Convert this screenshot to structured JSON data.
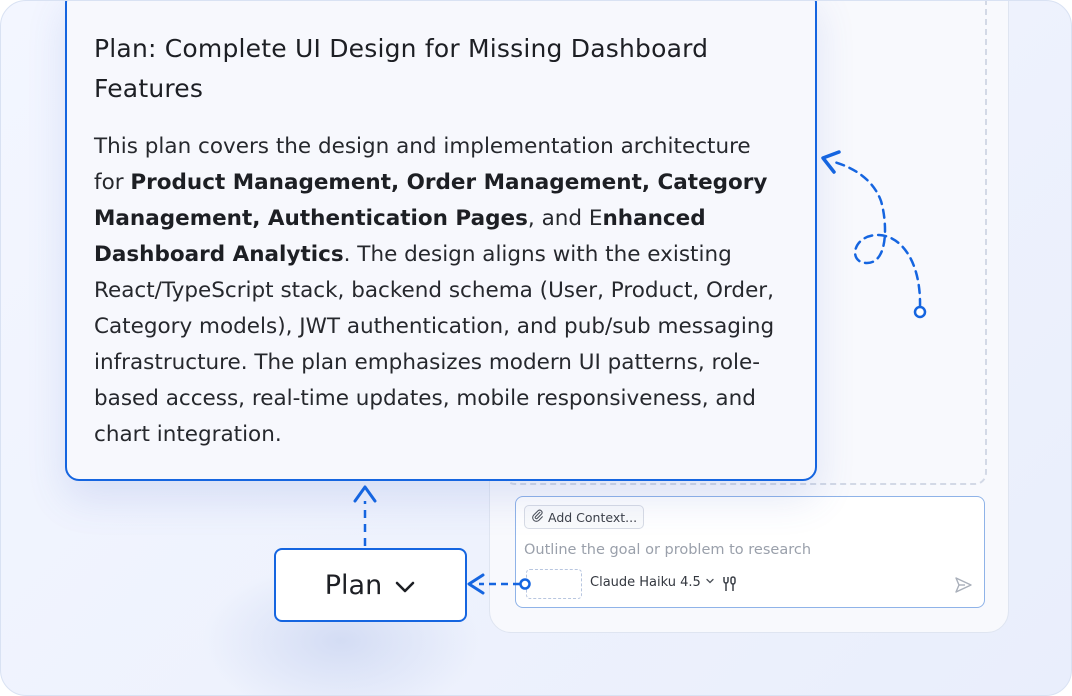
{
  "plan_card": {
    "title": "Plan: Complete UI Design for Missing Dashboard Features",
    "body_1": "This plan covers the design and implementation architecture for ",
    "bold_1": "Product Management, Order Management, Category Management, Authentication Pages",
    "body_2": ", and E",
    "bold_2": "nhanced Dashboard Analytics",
    "body_3": ". The design aligns with the existing React/TypeScript stack, backend schema (User, Product, Order, Category models), JWT authentication, and pub/sub messaging infrastructure. The plan emphasizes modern UI patterns, role-based access, real-time updates, mobile responsiveness, and chart integration."
  },
  "chat": {
    "add_context_label": "Add Context...",
    "placeholder": "Outline the goal or problem to research",
    "model_label": "Claude Haiku 4.5",
    "icons": [
      "paperclip-icon",
      "chevron-down-icon",
      "tools-icon",
      "send-icon"
    ]
  },
  "mode_button": {
    "label": "Plan",
    "icon": "chevron-down-icon"
  },
  "colors": {
    "accent": "#1565e0",
    "background": "#eef2fd",
    "panel": "#f8f9fd"
  }
}
